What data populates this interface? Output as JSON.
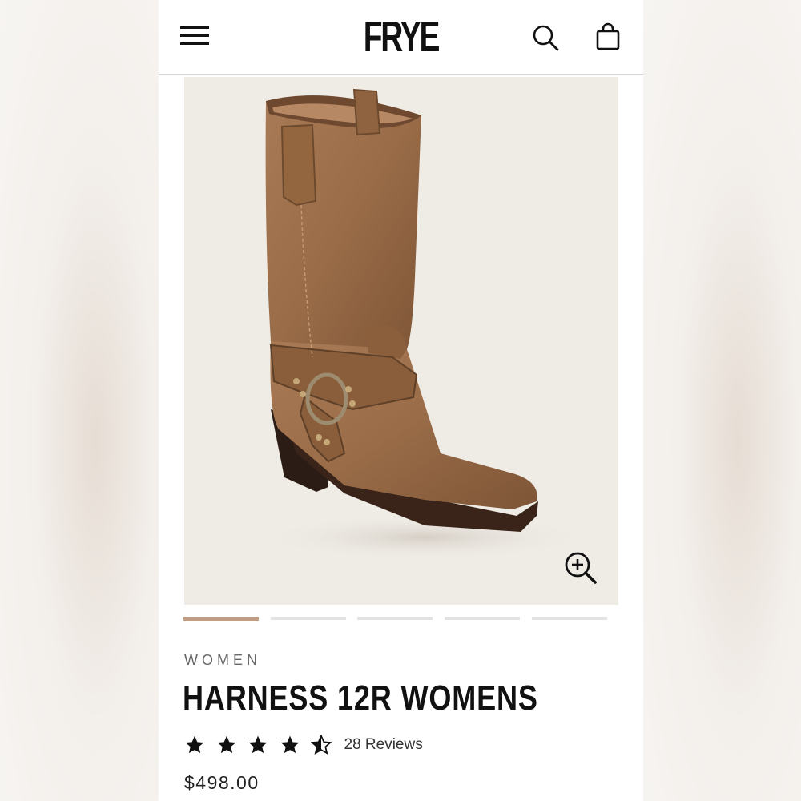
{
  "header": {
    "brand": "FRYE",
    "icons": [
      "menu-icon",
      "search-icon",
      "shopping-bag-icon"
    ]
  },
  "gallery": {
    "active_slide": 1,
    "slide_count": 5,
    "zoom_icon": "zoom-in-icon",
    "accent_color": "#c49c82"
  },
  "product": {
    "category": "WOMEN",
    "title": "HARNESS 12R WOMENS",
    "rating": 4.5,
    "rating_max": 5,
    "reviews": "28 Reviews",
    "price": "$498.00"
  }
}
